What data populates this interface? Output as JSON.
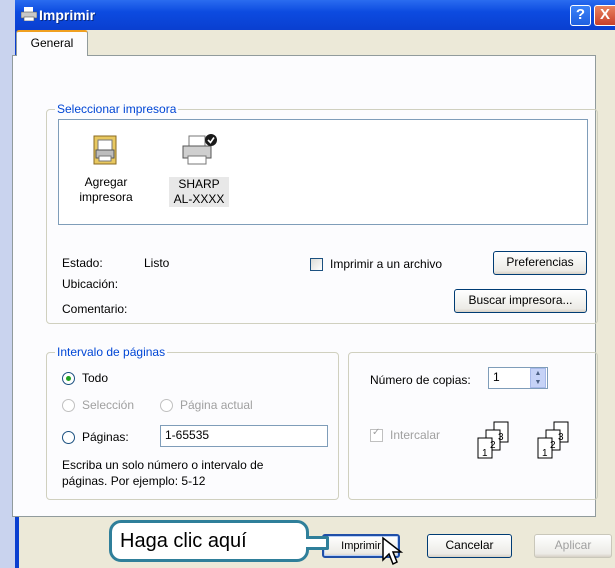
{
  "window": {
    "title": "Imprimir",
    "help_label": "?",
    "close_label": "X"
  },
  "tabs": [
    "General"
  ],
  "printer_group": {
    "legend": "Seleccionar impresora",
    "printers": [
      {
        "line1": "Agregar",
        "line2": "impresora",
        "icon": "add-printer-icon"
      },
      {
        "line1": "SHARP",
        "line2": "AL-XXXX",
        "icon": "printer-icon",
        "selected": true
      }
    ],
    "status_label": "Estado:",
    "status_value": "Listo",
    "location_label": "Ubicación:",
    "comment_label": "Comentario:",
    "print_to_file_label": "Imprimir a un archivo",
    "preferences_button": "Preferencias",
    "find_printer_button": "Buscar impresora..."
  },
  "page_range": {
    "legend": "Intervalo de páginas",
    "all_label": "Todo",
    "selection_label": "Selección",
    "current_page_label": "Página actual",
    "pages_label": "Páginas:",
    "pages_value": "1-65535",
    "hint_line1": "Escriba un solo número o intervalo de",
    "hint_line2": "páginas. Por ejemplo: 5-12"
  },
  "copies": {
    "label": "Número de copias:",
    "value": "1",
    "collate_label": "Intercalar",
    "collate_pages": [
      "1",
      "2",
      "3"
    ]
  },
  "buttons": {
    "print": "Imprimir",
    "cancel": "Cancelar",
    "apply": "Aplicar"
  },
  "callout": {
    "text": "Haga clic aquí"
  },
  "colors": {
    "titlebar": "#0a3fd0",
    "group_legend": "#0046d5",
    "callout_border": "#2f7f9a"
  }
}
